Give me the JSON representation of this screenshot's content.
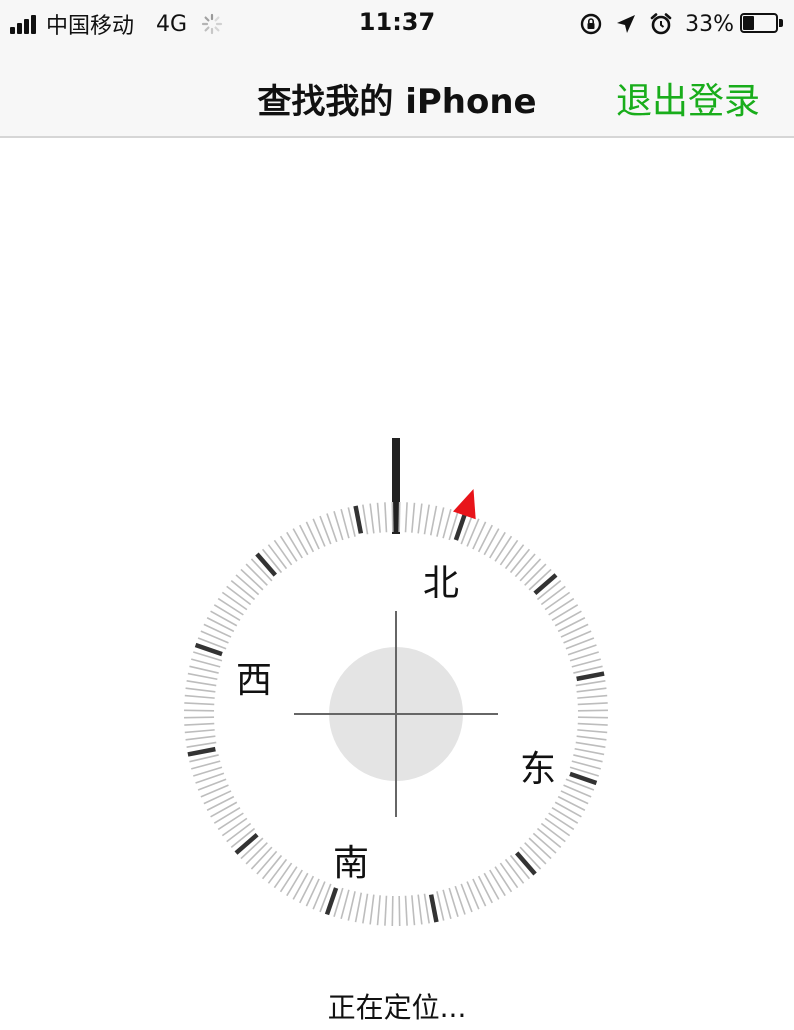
{
  "status_bar": {
    "carrier": "中国移动",
    "network": "4G",
    "time": "11:37",
    "battery_percent": "33%",
    "battery_level": 0.33,
    "icons": [
      "signal-icon",
      "activity-spinner-icon",
      "orientation-lock-icon",
      "location-arrow-icon",
      "alarm-icon",
      "battery-icon"
    ]
  },
  "nav": {
    "title": "查找我的 iPhone",
    "logout_label": "退出登录"
  },
  "compass": {
    "north": "北",
    "east": "东",
    "south": "南",
    "west": "西",
    "rotation_deg": 19,
    "marker_color": "#e8141a",
    "major_tick_color": "#333333",
    "minor_tick_color": "#bdbdbd",
    "center_disc_color": "#e4e4e4"
  },
  "status": {
    "text": "正在定位..."
  },
  "colors": {
    "accent": "#19ad1b",
    "bar_background": "#f7f7f7"
  }
}
